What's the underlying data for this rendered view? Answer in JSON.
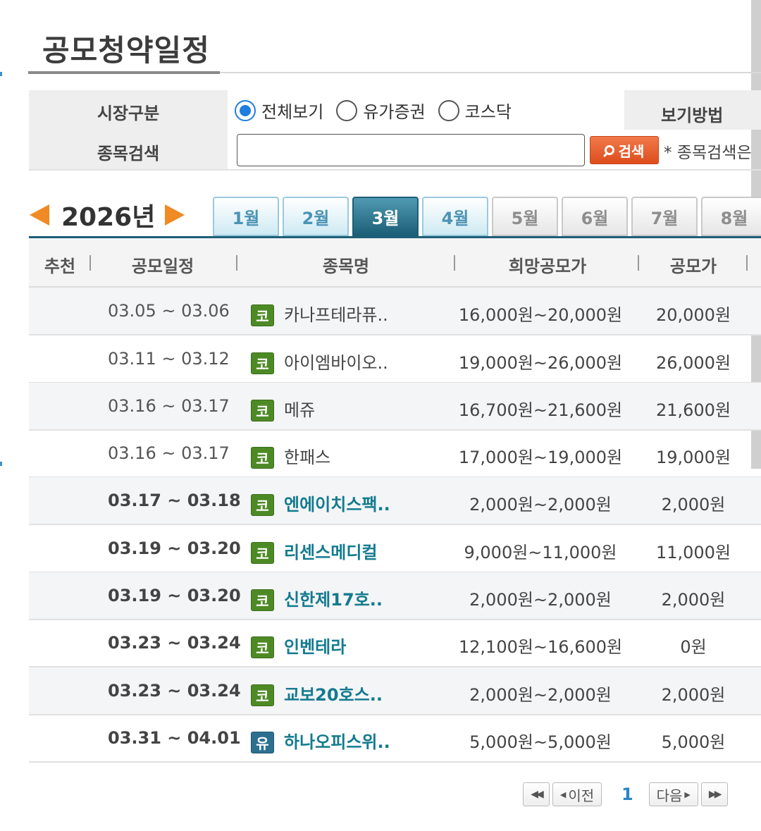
{
  "page": {
    "title": "공모청약일정"
  },
  "filters": {
    "market_label": "시장구분",
    "search_label": "종목검색",
    "view_method_label": "보기방법",
    "market_options": [
      {
        "label": "전체보기",
        "checked": true
      },
      {
        "label": "유가증권",
        "checked": false
      },
      {
        "label": "코스닥",
        "checked": false
      }
    ],
    "search_value": "",
    "search_button_label": "검색",
    "search_note": "* 종목검색은"
  },
  "calendar": {
    "year": "2026년",
    "months": [
      {
        "label": "1월",
        "state": "past"
      },
      {
        "label": "2월",
        "state": "past"
      },
      {
        "label": "3월",
        "state": "current"
      },
      {
        "label": "4월",
        "state": "past"
      },
      {
        "label": "5월",
        "state": "future"
      },
      {
        "label": "6월",
        "state": "future"
      },
      {
        "label": "7월",
        "state": "future"
      },
      {
        "label": "8월",
        "state": "future"
      }
    ]
  },
  "table": {
    "headers": {
      "recommend": "추천",
      "schedule": "공모일정",
      "name": "종목명",
      "hope_price": "희망공모가",
      "ipo_price": "공모가"
    },
    "rows": [
      {
        "date": "03.05 ~ 03.06",
        "market": "코",
        "market_type": "kosdaq",
        "name": "카나프테라퓨..",
        "range": "16,000원~20,000원",
        "price": "20,000원",
        "bold": false
      },
      {
        "date": "03.11 ~ 03.12",
        "market": "코",
        "market_type": "kosdaq",
        "name": "아이엠바이오..",
        "range": "19,000원~26,000원",
        "price": "26,000원",
        "bold": false
      },
      {
        "date": "03.16 ~ 03.17",
        "market": "코",
        "market_type": "kosdaq",
        "name": "메쥬",
        "range": "16,700원~21,600원",
        "price": "21,600원",
        "bold": false
      },
      {
        "date": "03.16 ~ 03.17",
        "market": "코",
        "market_type": "kosdaq",
        "name": "한패스",
        "range": "17,000원~19,000원",
        "price": "19,000원",
        "bold": false
      },
      {
        "date": "03.17 ~ 03.18",
        "market": "코",
        "market_type": "kosdaq",
        "name": "엔에이치스팩..",
        "range": "2,000원~2,000원",
        "price": "2,000원",
        "bold": true
      },
      {
        "date": "03.19 ~ 03.20",
        "market": "코",
        "market_type": "kosdaq",
        "name": "리센스메디컬",
        "range": "9,000원~11,000원",
        "price": "11,000원",
        "bold": true
      },
      {
        "date": "03.19 ~ 03.20",
        "market": "코",
        "market_type": "kosdaq",
        "name": "신한제17호..",
        "range": "2,000원~2,000원",
        "price": "2,000원",
        "bold": true
      },
      {
        "date": "03.23 ~ 03.24",
        "market": "코",
        "market_type": "kosdaq",
        "name": "인벤테라",
        "range": "12,100원~16,600원",
        "price": "0원",
        "bold": true
      },
      {
        "date": "03.23 ~ 03.24",
        "market": "코",
        "market_type": "kosdaq",
        "name": "교보20호스..",
        "range": "2,000원~2,000원",
        "price": "2,000원",
        "bold": true
      },
      {
        "date": "03.31 ~ 04.01",
        "market": "유",
        "market_type": "kospi",
        "name": "하나오피스위..",
        "range": "5,000원~5,000원",
        "price": "5,000원",
        "bold": true
      }
    ]
  },
  "pagination": {
    "prev_label": "이전",
    "next_label": "다음",
    "current_page": "1"
  },
  "colors": {
    "accent": "#1d5f78",
    "link": "#137b8f",
    "kosdaq_badge": "#4d8a25",
    "kospi_badge": "#2d6f8f",
    "search_button": "#dd4d1d",
    "year_arrow": "#ef8a24"
  }
}
